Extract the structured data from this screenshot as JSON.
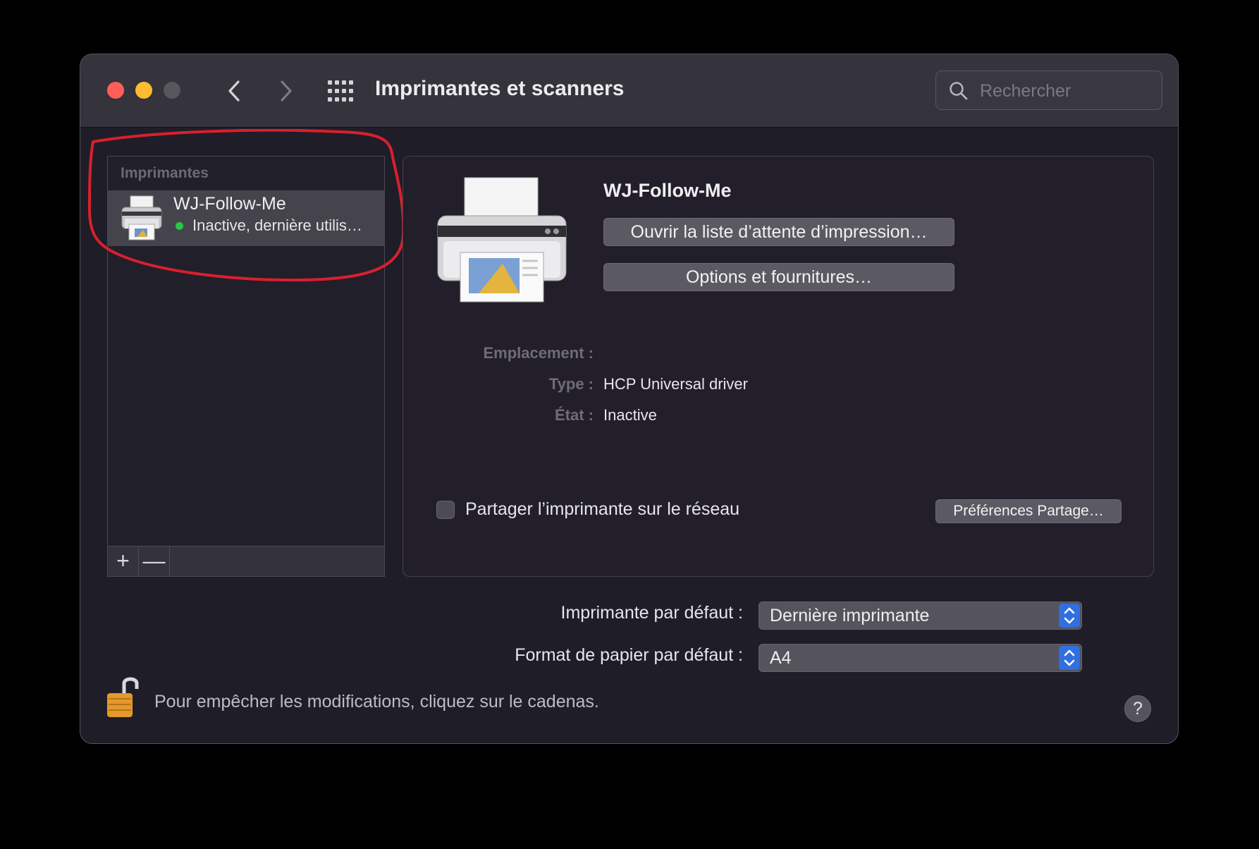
{
  "window": {
    "title": "Imprimantes et scanners",
    "search": {
      "placeholder": "Rechercher",
      "value": ""
    }
  },
  "sidebar": {
    "header": "Imprimantes",
    "printers": [
      {
        "name": "WJ-Follow-Me",
        "status": "Inactive, dernière utilis…",
        "status_color": "#28c840",
        "icon": "printer-icon"
      }
    ],
    "add_label": "+",
    "remove_label": "—"
  },
  "detail": {
    "printer_name": "WJ-Follow-Me",
    "open_queue_label": "Ouvrir la liste d’attente d’impression…",
    "options_label": "Options et fournitures…",
    "location_label": "Emplacement :",
    "location_value": "",
    "type_label": "Type :",
    "type_value": "HCP Universal driver",
    "state_label": "État :",
    "state_value": "Inactive",
    "share_label": "Partager l’imprimante sur le réseau",
    "share_checked": false,
    "share_prefs_label": "Préférences Partage…"
  },
  "defaults": {
    "printer_label": "Imprimante par défaut :",
    "printer_value": "Dernière imprimante",
    "paper_label": "Format de papier par défaut :",
    "paper_value": "A4"
  },
  "footer": {
    "lock_text": "Pour empêcher les modifications, cliquez sur le cadenas.",
    "help_label": "?"
  },
  "colors": {
    "annotation": "#d8202e",
    "accent": "#2f6fe0"
  }
}
